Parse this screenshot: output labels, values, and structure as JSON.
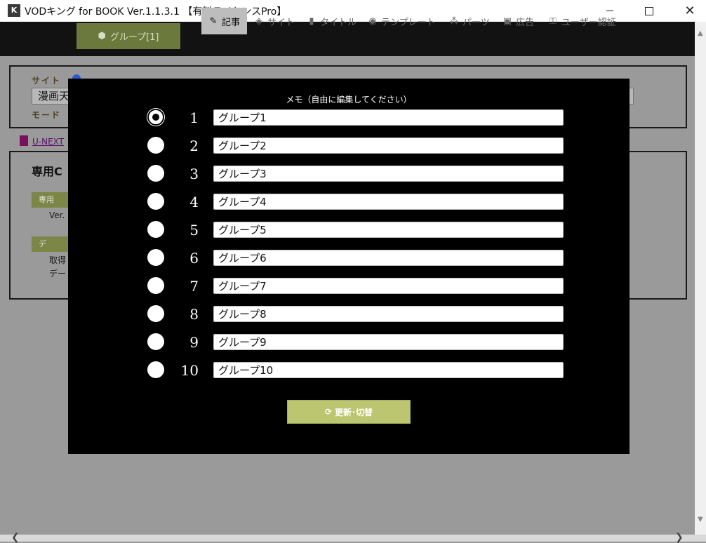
{
  "window": {
    "logo_text": "K",
    "title": "VODキング for BOOK Ver.1.1.3.1 【有料ライセンスPro】"
  },
  "nav": {
    "group_button": "グループ[1]",
    "tabs": [
      {
        "label": "記事",
        "icon": "pen-icon",
        "active": true
      },
      {
        "label": "サイト",
        "icon": "layers-icon",
        "active": false
      },
      {
        "label": "タイトル",
        "icon": "bookmark-icon",
        "active": false
      },
      {
        "label": "テンプレート",
        "icon": "palette-icon",
        "active": false
      },
      {
        "label": "パーツ",
        "icon": "cubes-icon",
        "active": false
      },
      {
        "label": "広告",
        "icon": "ad-icon",
        "active": false
      },
      {
        "label": "ユーザー認証",
        "icon": "unlock-icon",
        "active": false
      }
    ]
  },
  "background": {
    "site_label": "サイト",
    "site_value": "漫画天",
    "mode_label": "モード",
    "link": "U-NEXT",
    "heading": "専用C",
    "button1": "専用",
    "text1": "Ver.",
    "button2": "デ",
    "text2": "取得",
    "text3": "デー"
  },
  "modal": {
    "memo_label": "メモ（自由に編集してください）",
    "selected_index": 0,
    "groups": [
      {
        "num": "1",
        "value": "グループ1"
      },
      {
        "num": "2",
        "value": "グループ2"
      },
      {
        "num": "3",
        "value": "グループ3"
      },
      {
        "num": "4",
        "value": "グループ4"
      },
      {
        "num": "5",
        "value": "グループ5"
      },
      {
        "num": "6",
        "value": "グループ6"
      },
      {
        "num": "7",
        "value": "グループ7"
      },
      {
        "num": "8",
        "value": "グループ8"
      },
      {
        "num": "9",
        "value": "グループ9"
      },
      {
        "num": "10",
        "value": "グループ10"
      }
    ],
    "update_button": "更新･切替"
  },
  "colors": {
    "modal_bg": "#000000",
    "accent_button": "#bcc56f",
    "group_button": "#6b7a3c"
  }
}
